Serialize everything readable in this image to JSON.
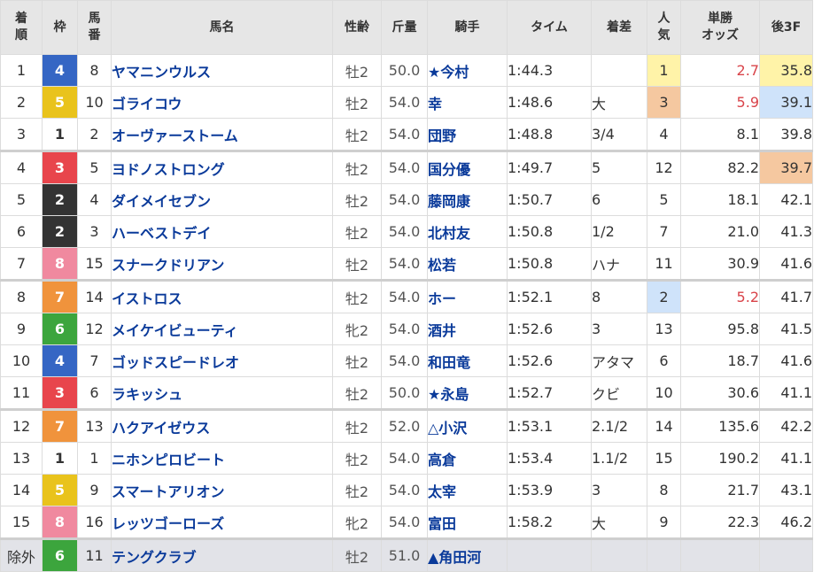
{
  "headers": {
    "rank": [
      "着",
      "順"
    ],
    "waku": "枠",
    "umaban": [
      "馬",
      "番"
    ],
    "name": "馬名",
    "sexage": "性齢",
    "weight": "斤量",
    "jockey": "騎手",
    "time": "タイム",
    "margin": "着差",
    "popularity": [
      "人",
      "気"
    ],
    "odds": [
      "単勝",
      "オッズ"
    ],
    "last3f": "後3F"
  },
  "waku_colors": {
    "1": {
      "bg": "#ffffff",
      "fg": "#333333"
    },
    "2": {
      "bg": "#333333",
      "fg": "#ffffff"
    },
    "3": {
      "bg": "#e8454c",
      "fg": "#ffffff"
    },
    "4": {
      "bg": "#3566c4",
      "fg": "#ffffff"
    },
    "5": {
      "bg": "#e9c31c",
      "fg": "#ffffff"
    },
    "6": {
      "bg": "#3ca53d",
      "fg": "#ffffff"
    },
    "7": {
      "bg": "#f0933c",
      "fg": "#ffffff"
    },
    "8": {
      "bg": "#f0899f",
      "fg": "#ffffff"
    }
  },
  "rows": [
    {
      "rank": "1",
      "waku": "4",
      "umaban": "8",
      "name": "ヤマニンウルス",
      "sexage": "牡2",
      "weight": "50.0",
      "jockey": "★今村",
      "time": "1:44.3",
      "margin": "",
      "popularity": "1",
      "odds": "2.7",
      "last3f": "35.8"
    },
    {
      "rank": "2",
      "waku": "5",
      "umaban": "10",
      "name": "ゴライコウ",
      "sexage": "牡2",
      "weight": "54.0",
      "jockey": "幸",
      "time": "1:48.6",
      "margin": "大",
      "popularity": "3",
      "odds": "5.9",
      "last3f": "39.1"
    },
    {
      "rank": "3",
      "waku": "1",
      "umaban": "2",
      "name": "オーヴァーストーム",
      "sexage": "牡2",
      "weight": "54.0",
      "jockey": "団野",
      "time": "1:48.8",
      "margin": "3/4",
      "popularity": "4",
      "odds": "8.1",
      "last3f": "39.8"
    },
    {
      "rank": "4",
      "waku": "3",
      "umaban": "5",
      "name": "ヨドノストロング",
      "sexage": "牡2",
      "weight": "54.0",
      "jockey": "国分優",
      "time": "1:49.7",
      "margin": "5",
      "popularity": "12",
      "odds": "82.2",
      "last3f": "39.7"
    },
    {
      "rank": "5",
      "waku": "2",
      "umaban": "4",
      "name": "ダイメイセブン",
      "sexage": "牡2",
      "weight": "54.0",
      "jockey": "藤岡康",
      "time": "1:50.7",
      "margin": "6",
      "popularity": "5",
      "odds": "18.1",
      "last3f": "42.1"
    },
    {
      "rank": "6",
      "waku": "2",
      "umaban": "3",
      "name": "ハーベストデイ",
      "sexage": "牡2",
      "weight": "54.0",
      "jockey": "北村友",
      "time": "1:50.8",
      "margin": "1/2",
      "popularity": "7",
      "odds": "21.0",
      "last3f": "41.3"
    },
    {
      "rank": "7",
      "waku": "8",
      "umaban": "15",
      "name": "スナークドリアン",
      "sexage": "牡2",
      "weight": "54.0",
      "jockey": "松若",
      "time": "1:50.8",
      "margin": "ハナ",
      "popularity": "11",
      "odds": "30.9",
      "last3f": "41.6"
    },
    {
      "rank": "8",
      "waku": "7",
      "umaban": "14",
      "name": "イストロス",
      "sexage": "牡2",
      "weight": "54.0",
      "jockey": "ホー",
      "time": "1:52.1",
      "margin": "8",
      "popularity": "2",
      "odds": "5.2",
      "last3f": "41.7"
    },
    {
      "rank": "9",
      "waku": "6",
      "umaban": "12",
      "name": "メイケイビューティ",
      "sexage": "牝2",
      "weight": "54.0",
      "jockey": "酒井",
      "time": "1:52.6",
      "margin": "3",
      "popularity": "13",
      "odds": "95.8",
      "last3f": "41.5"
    },
    {
      "rank": "10",
      "waku": "4",
      "umaban": "7",
      "name": "ゴッドスピードレオ",
      "sexage": "牡2",
      "weight": "54.0",
      "jockey": "和田竜",
      "time": "1:52.6",
      "margin": "アタマ",
      "popularity": "6",
      "odds": "18.7",
      "last3f": "41.6"
    },
    {
      "rank": "11",
      "waku": "3",
      "umaban": "6",
      "name": "ラキッシュ",
      "sexage": "牡2",
      "weight": "50.0",
      "jockey": "★永島",
      "time": "1:52.7",
      "margin": "クビ",
      "popularity": "10",
      "odds": "30.6",
      "last3f": "41.1"
    },
    {
      "rank": "12",
      "waku": "7",
      "umaban": "13",
      "name": "ハクアイゼウス",
      "sexage": "牡2",
      "weight": "52.0",
      "jockey": "△小沢",
      "time": "1:53.1",
      "margin": "2.1/2",
      "popularity": "14",
      "odds": "135.6",
      "last3f": "42.2"
    },
    {
      "rank": "13",
      "waku": "1",
      "umaban": "1",
      "name": "ニホンピロビート",
      "sexage": "牡2",
      "weight": "54.0",
      "jockey": "高倉",
      "time": "1:53.4",
      "margin": "1.1/2",
      "popularity": "15",
      "odds": "190.2",
      "last3f": "41.1"
    },
    {
      "rank": "14",
      "waku": "5",
      "umaban": "9",
      "name": "スマートアリオン",
      "sexage": "牡2",
      "weight": "54.0",
      "jockey": "太宰",
      "time": "1:53.9",
      "margin": "3",
      "popularity": "8",
      "odds": "21.7",
      "last3f": "43.1"
    },
    {
      "rank": "15",
      "waku": "8",
      "umaban": "16",
      "name": "レッツゴーローズ",
      "sexage": "牝2",
      "weight": "54.0",
      "jockey": "富田",
      "time": "1:58.2",
      "margin": "大",
      "popularity": "9",
      "odds": "22.3",
      "last3f": "46.2"
    },
    {
      "rank": "除外",
      "waku": "6",
      "umaban": "11",
      "name": "テングクラブ",
      "sexage": "牡2",
      "weight": "51.0",
      "jockey": "▲角田河",
      "time": "",
      "margin": "",
      "popularity": "",
      "odds": "",
      "last3f": ""
    }
  ]
}
